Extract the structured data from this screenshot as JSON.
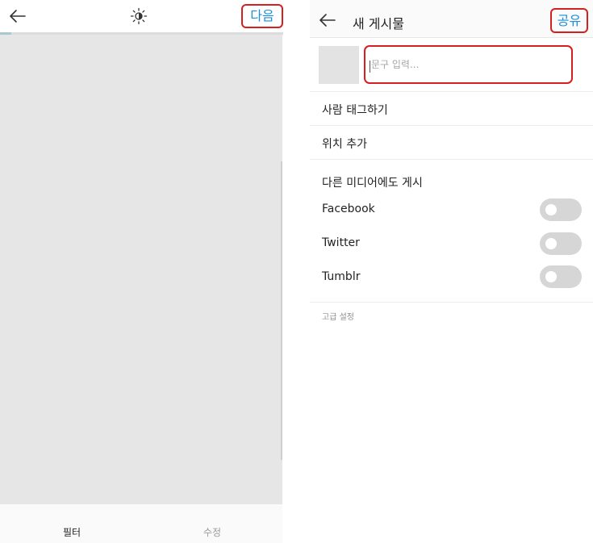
{
  "left_screen": {
    "next_label": "다음",
    "tabs": [
      {
        "label": "필터",
        "active": true
      },
      {
        "label": "수정",
        "active": false
      }
    ],
    "icons": {
      "back": "back-arrow-icon",
      "adjust": "brightness-icon"
    }
  },
  "right_screen": {
    "title": "새 게시물",
    "share_label": "공유",
    "caption": {
      "placeholder": "문구 입력...",
      "value": ""
    },
    "tag_people_label": "사람 태그하기",
    "add_location_label": "위치 추가",
    "share_to_other_media_label": "다른 미디어에도 게시",
    "share_targets": [
      {
        "label": "Facebook",
        "enabled": false
      },
      {
        "label": "Twitter",
        "enabled": false
      },
      {
        "label": "Tumblr",
        "enabled": false
      }
    ],
    "advanced_settings_label": "고급 설정",
    "icons": {
      "back": "back-arrow-icon"
    }
  },
  "colors": {
    "accent_blue": "#1c8fd8",
    "highlight_red": "#d61f1f",
    "toggle_off": "#d6d6d6",
    "photo_placeholder": "#e6e6e6"
  }
}
